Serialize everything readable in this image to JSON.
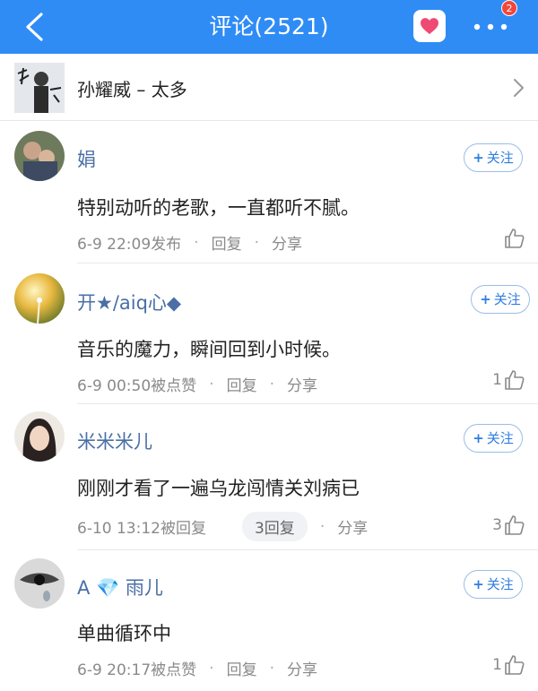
{
  "header": {
    "title": "评论(2521)",
    "badge_count": "2"
  },
  "song": {
    "title": "孙耀威 – 太多"
  },
  "comments": [
    {
      "username": "娟",
      "follow_label": "关注",
      "content": "特别动听的老歌，一直都听不腻。",
      "time": "6-9 22:09发布",
      "reply_label": "回复",
      "share_label": "分享",
      "likes": ""
    },
    {
      "username": "开★/aiq心◆",
      "follow_label": "关注",
      "content": "音乐的魔力，瞬间回到小时候。",
      "time": "6-9 00:50被点赞",
      "reply_label": "回复",
      "share_label": "分享",
      "likes": "1"
    },
    {
      "username": "米米米儿",
      "follow_label": "关注",
      "content": "刚刚才看了一遍乌龙闯情关刘病已",
      "time": "6-10 13:12被回复",
      "replies_count": "3回复",
      "share_label": "分享",
      "likes": "3"
    },
    {
      "username": "A 💎 雨儿",
      "follow_label": "关注",
      "content": "单曲循环中",
      "time": "6-9 20:17被点赞",
      "reply_label": "回复",
      "share_label": "分享",
      "likes": "1"
    }
  ],
  "colors": {
    "header_bg": "#2f8cf5",
    "username": "#4a6fa5",
    "follow": "#2f7de0",
    "badge": "#f2463c"
  }
}
